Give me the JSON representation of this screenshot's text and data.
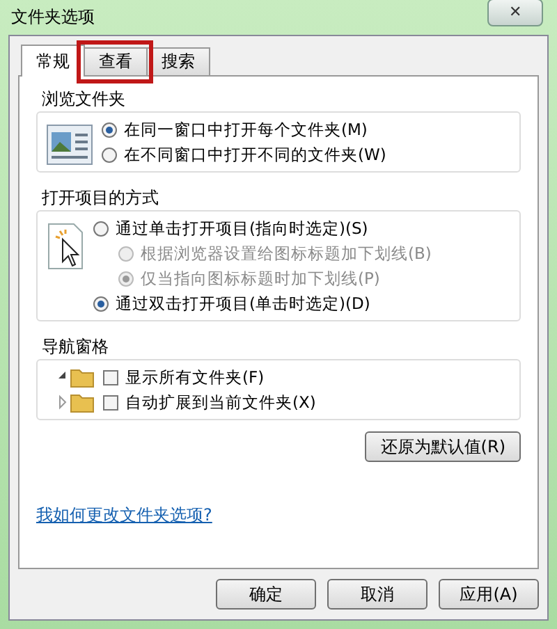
{
  "window": {
    "title": "文件夹选项",
    "close": "✕"
  },
  "tabs": [
    {
      "label": "常规",
      "selected": true,
      "highlighted": false
    },
    {
      "label": "查看",
      "selected": false,
      "highlighted": true
    },
    {
      "label": "搜索",
      "selected": false,
      "highlighted": false
    }
  ],
  "groups": [
    {
      "title": "浏览文件夹",
      "options": [
        {
          "kind": "radio",
          "label": "在同一窗口中打开每个文件夹(M)",
          "selected": true,
          "disabled": false
        },
        {
          "kind": "radio",
          "label": "在不同窗口中打开不同的文件夹(W)",
          "selected": false,
          "disabled": false
        }
      ]
    },
    {
      "title": "打开项目的方式",
      "options": [
        {
          "kind": "radio",
          "label": "通过单击打开项目(指向时选定)(S)",
          "selected": false,
          "disabled": false,
          "indent": false
        },
        {
          "kind": "radio",
          "label": "根据浏览器设置给图标标题加下划线(B)",
          "selected": false,
          "disabled": true,
          "indent": true
        },
        {
          "kind": "radio",
          "label": "仅当指向图标标题时加下划线(P)",
          "selected": true,
          "disabled": true,
          "indent": true
        },
        {
          "kind": "radio",
          "label": "通过双击打开项目(单击时选定)(D)",
          "selected": true,
          "disabled": false,
          "indent": false
        }
      ]
    },
    {
      "title": "导航窗格",
      "options": [
        {
          "kind": "checkbox",
          "label": "显示所有文件夹(F)",
          "checked": false
        },
        {
          "kind": "checkbox",
          "label": "自动扩展到当前文件夹(X)",
          "checked": false
        }
      ]
    }
  ],
  "restore_button": "还原为默认值(R)",
  "help_link": "我如何更改文件夹选项?",
  "buttons": [
    "确定",
    "取消",
    "应用(A)"
  ]
}
